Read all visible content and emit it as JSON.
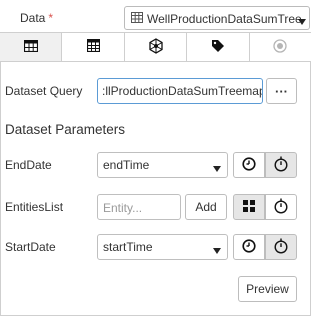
{
  "header": {
    "data_label": "Data",
    "required_mark": "*",
    "dataset_value": "WellProductionDataSumTreemap"
  },
  "tabs": [
    {
      "icon": "table-icon",
      "active": true
    },
    {
      "icon": "calculator-icon",
      "active": false
    },
    {
      "icon": "network-icon",
      "active": false
    },
    {
      "icon": "tag-icon",
      "active": false
    },
    {
      "icon": "record-icon",
      "active": false
    }
  ],
  "query": {
    "label": "Dataset Query",
    "value": ":llProductionDataSumTreemap",
    "more_label": "···"
  },
  "params": {
    "title": "Dataset Parameters",
    "end_date": {
      "label": "EndDate",
      "value": "endTime"
    },
    "entities": {
      "label": "EntitiesList",
      "placeholder": "Entity...",
      "add_label": "Add"
    },
    "start_date": {
      "label": "StartDate",
      "value": "startTime"
    }
  },
  "preview_label": "Preview"
}
